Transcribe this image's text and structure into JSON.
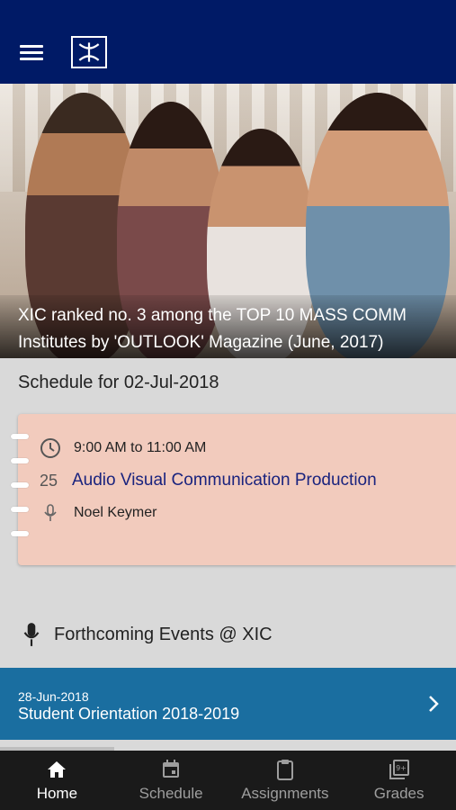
{
  "header": {
    "menu_icon": "hamburger-menu-icon",
    "logo_icon": "xic-logo-icon"
  },
  "hero": {
    "caption": "XIC ranked no. 3 among the TOP 10 MASS COMM Institutes by 'OUTLOOK' Magazine (June, 2017)"
  },
  "schedule": {
    "title": "Schedule for 02-Jul-2018",
    "card": {
      "time": "9:00 AM to 11:00 AM",
      "count": "25",
      "course": "Audio Visual Communication Production",
      "teacher": "Noel Keymer"
    }
  },
  "events": {
    "title": "Forthcoming Events @ XIC",
    "item": {
      "date": "28-Jun-2018",
      "title": "Student Orientation 2018-2019"
    }
  },
  "bottom_nav": {
    "items": [
      {
        "label": "Home",
        "icon": "home-icon",
        "active": true
      },
      {
        "label": "Schedule",
        "icon": "calendar-icon",
        "active": false
      },
      {
        "label": "Assignments",
        "icon": "clipboard-icon",
        "active": false
      },
      {
        "label": "Grades",
        "icon": "grades-icon",
        "active": false
      }
    ]
  },
  "colors": {
    "appbar": "#001a66",
    "card": "#f2cbbd",
    "event_banner": "#1a6ea0",
    "nav_bg": "#1a1a1a"
  }
}
